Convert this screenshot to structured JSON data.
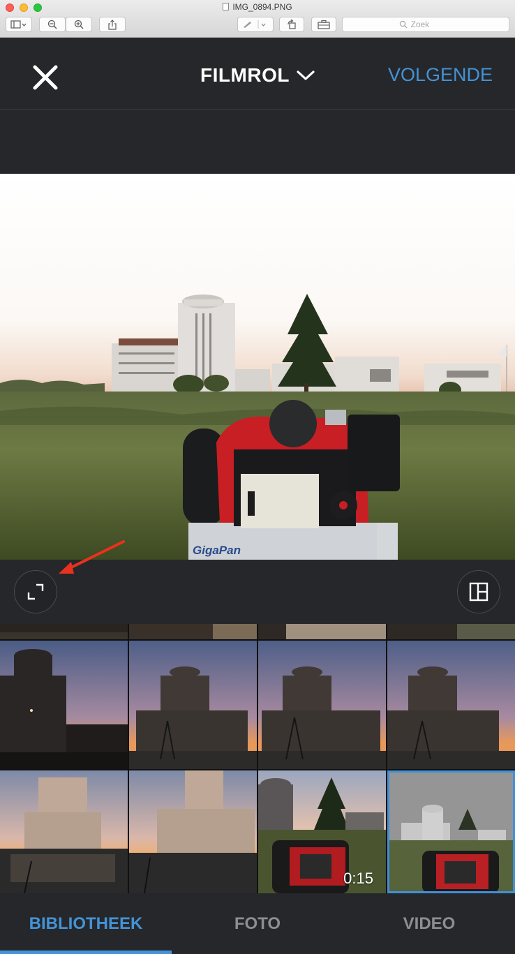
{
  "window": {
    "title": "IMG_0894.PNG",
    "search_placeholder": "Zoek"
  },
  "header": {
    "close_label": "×",
    "title": "FILMROL",
    "next_label": "VOLGENDE"
  },
  "preview": {
    "camera_brand": "GigaPan"
  },
  "grid": {
    "video_duration": "0:15"
  },
  "tabs": [
    {
      "label": "BIBLIOTHEEK",
      "active": true
    },
    {
      "label": "FOTO",
      "active": false
    },
    {
      "label": "VIDEO",
      "active": false
    }
  ],
  "colors": {
    "accent": "#4393d6",
    "background": "#26272b",
    "annotation_arrow": "#e8321d"
  }
}
